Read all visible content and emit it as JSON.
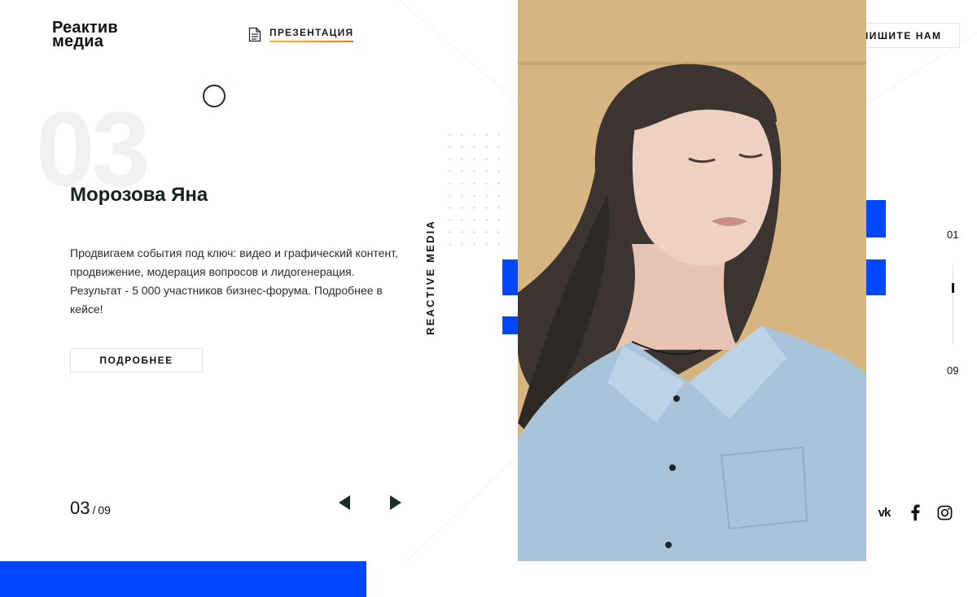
{
  "header": {
    "logo_line1": "Реактив",
    "logo_line2": "медиа",
    "presentation_label": "ПРЕЗЕНТАЦИЯ",
    "contact_label": "НАПИШИТЕ НАМ"
  },
  "slide": {
    "number_big": "03",
    "name": "Морозова Яна",
    "description": "Продвигаем события под ключ: видео и графический контент, продвижение, модерация вопросов и лидогенерация. Результат - 5 000 участников бизнес-форума. Подробнее в кейсе!",
    "more_label": "ПОДРОБНЕЕ"
  },
  "counter": {
    "current": "03",
    "separator": "/",
    "total": "09"
  },
  "vertical_text": "REACTIVE MEDIA",
  "pagination": {
    "first": "01",
    "last": "09",
    "progress": 0.25
  },
  "social": {
    "vk_label": "vk",
    "icons": [
      "vk-icon",
      "facebook-icon",
      "instagram-icon"
    ]
  },
  "colors": {
    "accent_blue": "#0047ff",
    "dark": "#1f2d2d",
    "photo_bg": "#d7b47f"
  }
}
